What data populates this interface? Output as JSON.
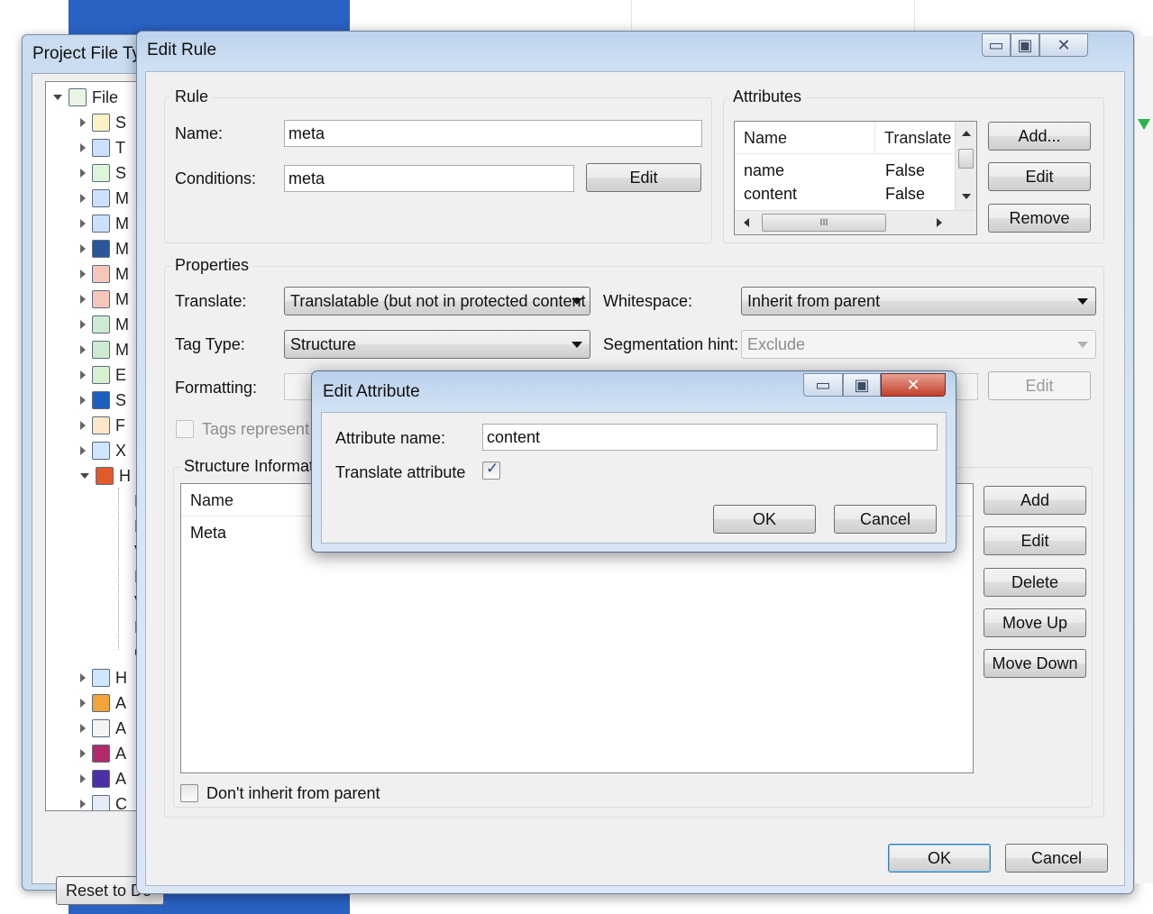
{
  "back_window": {
    "title": "Project File Ty",
    "tree_root_label": "File",
    "tree_items": [
      "S",
      "T",
      "S",
      "M",
      "M",
      "M",
      "M",
      "M",
      "M",
      "M",
      "E",
      "S",
      "F",
      "X",
      "H",
      "",
      "",
      "",
      "",
      "",
      "",
      "",
      "H",
      "A",
      "A",
      "A",
      "A",
      "C"
    ],
    "child_items": [
      "D",
      "P",
      "V",
      "E",
      "V",
      "F",
      "C"
    ],
    "reset_button": "Reset to De"
  },
  "edit_rule": {
    "title": "Edit Rule",
    "rule_group": {
      "title": "Rule",
      "name_label": "Name:",
      "name_value": "meta",
      "conditions_label": "Conditions:",
      "conditions_value": "meta",
      "edit_button": "Edit"
    },
    "attributes_group": {
      "title": "Attributes",
      "columns": [
        "Name",
        "Translate"
      ],
      "rows": [
        {
          "name": "name",
          "translate": "False"
        },
        {
          "name": "content",
          "translate": "False"
        }
      ],
      "add_button": "Add...",
      "edit_button": "Edit",
      "remove_button": "Remove",
      "hscroll_grip": "III"
    },
    "properties_group": {
      "title": "Properties",
      "translate_label": "Translate:",
      "translate_value": "Translatable (but not in protected content",
      "whitespace_label": "Whitespace:",
      "whitespace_value": "Inherit from parent",
      "tagtype_label": "Tag Type:",
      "tagtype_value": "Structure",
      "segmentation_label": "Segmentation hint:",
      "segmentation_value": "Exclude",
      "formatting_label": "Formatting:",
      "formatting_edit_button": "Edit",
      "tags_checkbox_label": "Tags represent f",
      "structure_title": "Structure Informatio",
      "structure_columns": [
        "Name"
      ],
      "structure_rows": [
        "Meta"
      ],
      "add_button": "Add",
      "edit_button": "Edit",
      "delete_button": "Delete",
      "move_up_button": "Move Up",
      "move_down_button": "Move Down",
      "dont_inherit_label": "Don't inherit from parent"
    },
    "ok_button": "OK",
    "cancel_button": "Cancel"
  },
  "edit_attribute": {
    "title": "Edit Attribute",
    "attr_name_label": "Attribute name:",
    "attr_name_value": "content",
    "translate_label": "Translate attribute",
    "translate_checked": true,
    "checkmark": "✓",
    "ok_button": "OK",
    "cancel_button": "Cancel"
  },
  "caption_glyphs": {
    "minimize": "▭",
    "maximize": "▣",
    "close": "✕"
  },
  "colors": {
    "title_bar": "#cfe0f3",
    "close_button": "#c3402b",
    "desktop_blue": "#2a62c4"
  }
}
